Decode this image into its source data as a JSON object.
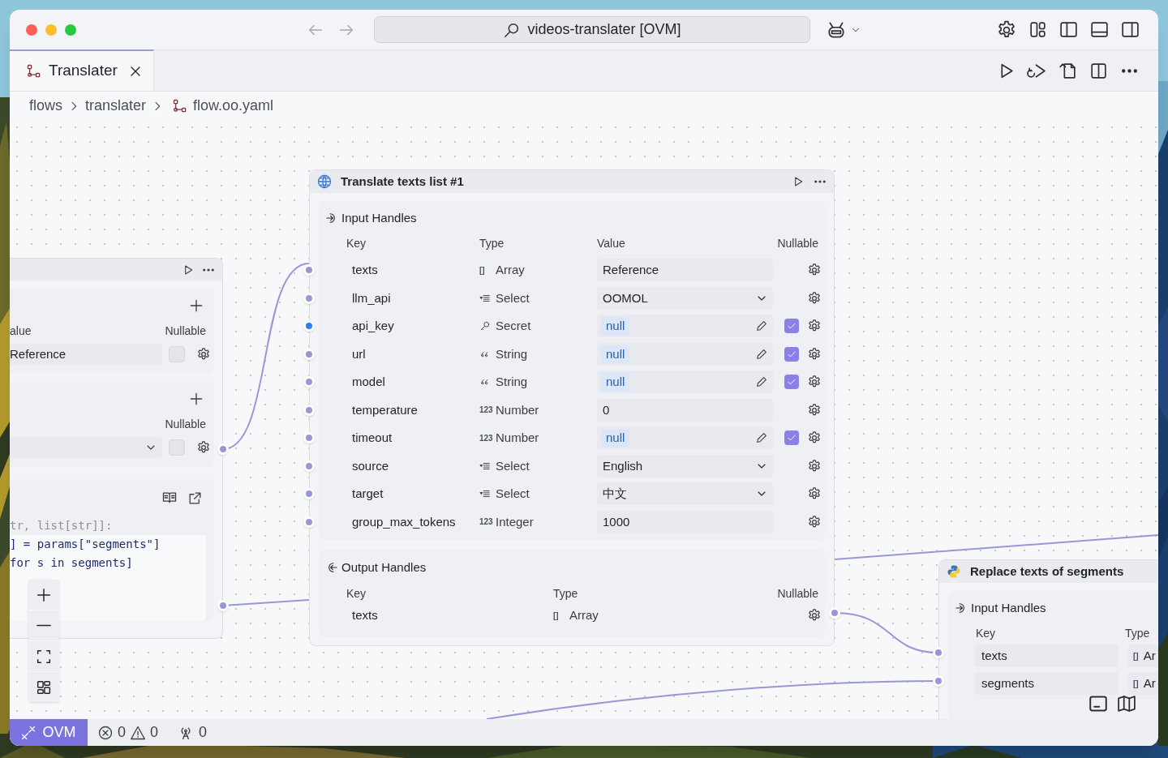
{
  "window": {
    "search": "videos-translater [OVM]"
  },
  "tabs": [
    {
      "label": "Translater",
      "selected": true
    }
  ],
  "breadcrumb": [
    "flows",
    "translater",
    "flow.oo.yaml"
  ],
  "left_node": {
    "sections": [
      {
        "kind": "field",
        "headers": [
          "alue",
          "Nullable"
        ],
        "field": "Reference",
        "nullable": false
      },
      {
        "kind": "select",
        "headers": [
          "Nullable"
        ],
        "nullable": false
      },
      {
        "kind": "code",
        "lines": [
          {
            "text": "tr, list[str]]:",
            "dimmed": true
          },
          {
            "text": "] = params[\"segments\"]",
            "dimmed": false
          },
          {
            "text": "for s in segments]",
            "dimmed": false
          }
        ]
      }
    ]
  },
  "main_node": {
    "title": "Translate texts list #1",
    "inputs": {
      "label": "Input Handles",
      "columns": [
        "Key",
        "Type",
        "Value",
        "Nullable"
      ],
      "rows": [
        {
          "key": "texts",
          "type": {
            "kind": "glyph",
            "icon": "[]",
            "label": "Array"
          },
          "kind": "field",
          "value": "Reference",
          "nullable": false,
          "highlighted": false
        },
        {
          "key": "llm_api",
          "type": {
            "kind": "select",
            "label": "Select"
          },
          "kind": "select",
          "value": "OOMOL",
          "nullable": false,
          "highlighted": false
        },
        {
          "key": "api_key",
          "type": {
            "kind": "secret",
            "label": "Secret"
          },
          "kind": "null",
          "value": "null",
          "nullable": true,
          "highlighted": true
        },
        {
          "key": "url",
          "type": {
            "kind": "string",
            "label": "String"
          },
          "kind": "null",
          "value": "null",
          "nullable": true,
          "highlighted": false
        },
        {
          "key": "model",
          "type": {
            "kind": "string",
            "label": "String"
          },
          "kind": "null",
          "value": "null",
          "nullable": true,
          "highlighted": false
        },
        {
          "key": "temperature",
          "type": {
            "kind": "glyph",
            "icon": "123",
            "label": "Number"
          },
          "kind": "field",
          "value": "0",
          "nullable": false,
          "highlighted": false
        },
        {
          "key": "timeout",
          "type": {
            "kind": "glyph",
            "icon": "123",
            "label": "Number"
          },
          "kind": "null",
          "value": "null",
          "nullable": true,
          "highlighted": false
        },
        {
          "key": "source",
          "type": {
            "kind": "select",
            "label": "Select"
          },
          "kind": "select",
          "value": "English",
          "nullable": false,
          "highlighted": false
        },
        {
          "key": "target",
          "type": {
            "kind": "select",
            "label": "Select"
          },
          "kind": "select",
          "value": "中文",
          "nullable": false,
          "highlighted": false
        },
        {
          "key": "group_max_tokens",
          "type": {
            "kind": "glyph",
            "icon": "123",
            "label": "Integer"
          },
          "kind": "field",
          "value": "1000",
          "nullable": false,
          "highlighted": false
        }
      ]
    },
    "outputs": {
      "label": "Output Handles",
      "columns": [
        "Key",
        "Type",
        "Nullable"
      ],
      "rows": [
        {
          "key": "texts",
          "type": {
            "kind": "glyph",
            "icon": "[]",
            "label": "Array"
          }
        }
      ]
    }
  },
  "right_node": {
    "title": "Replace texts of segments",
    "inputs": {
      "label": "Input Handles",
      "columns": [
        "Key",
        "Type"
      ],
      "rows": [
        {
          "key": "texts",
          "type": {
            "kind": "glyph",
            "icon": "[]",
            "label": "Ar"
          }
        },
        {
          "key": "segments",
          "type": {
            "kind": "glyph",
            "icon": "[]",
            "label": "Ar"
          }
        }
      ]
    }
  },
  "status_bar": {
    "remote": "OVM",
    "errors": "0",
    "warnings": "0",
    "ports": "0"
  }
}
